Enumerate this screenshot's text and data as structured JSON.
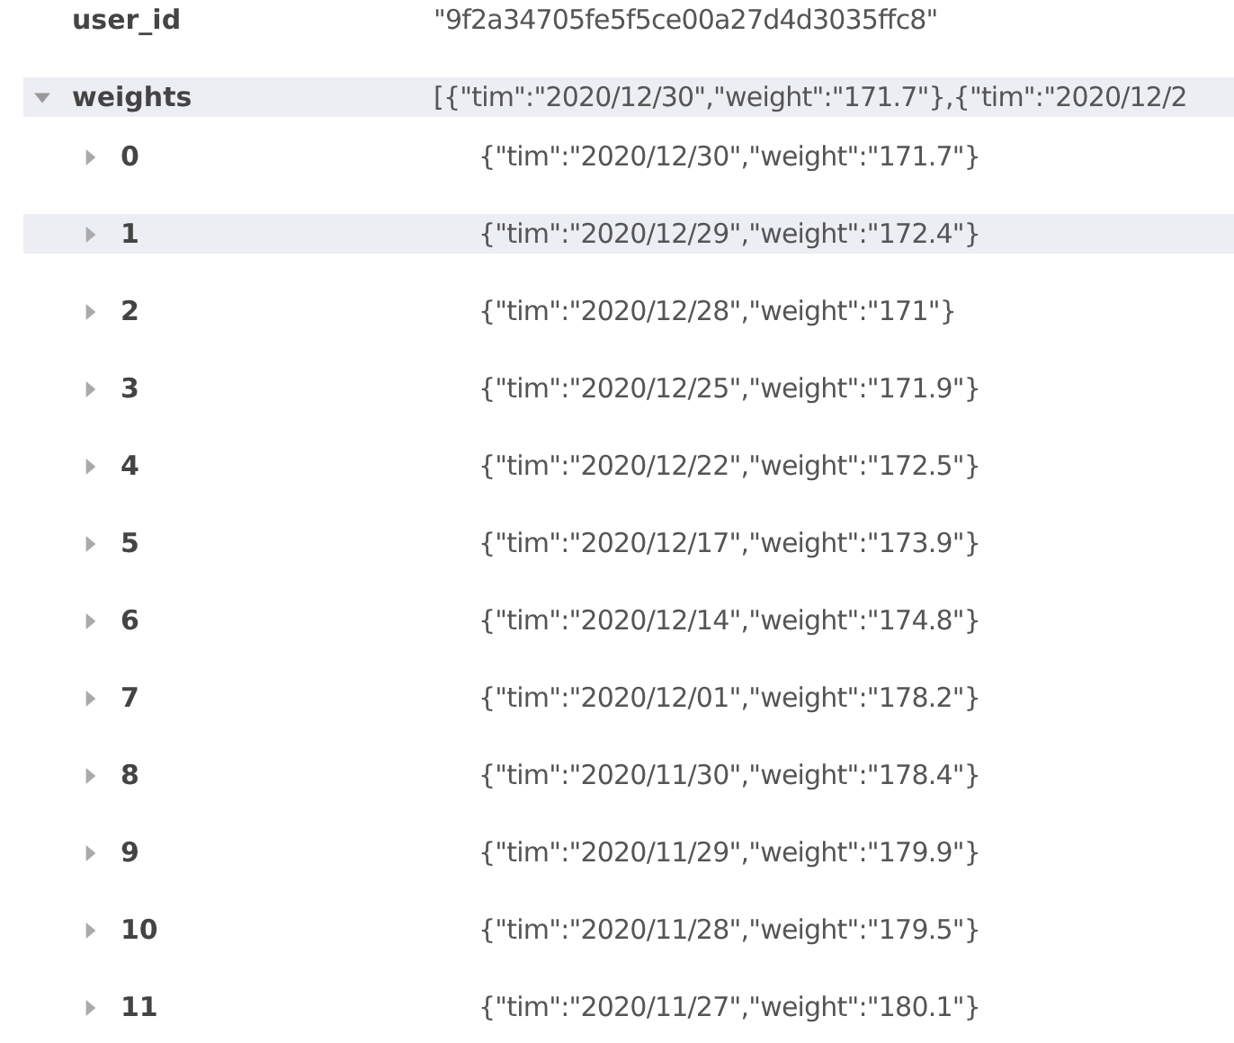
{
  "rows": [
    {
      "key": "user_id",
      "value": "\"9f2a34705fe5f5ce00a27d4d3035ffc8\"",
      "selected": false
    },
    {
      "key": "weights",
      "value": "[{\"tim\":\"2020/12/30\",\"weight\":\"171.7\"},{\"tim\":\"2020/12/2",
      "expanded": true,
      "selected": true,
      "children": [
        {
          "key": "0",
          "value": "{\"tim\":\"2020/12/30\",\"weight\":\"171.7\"}",
          "expanded": false,
          "selected": false
        },
        {
          "key": "1",
          "value": "{\"tim\":\"2020/12/29\",\"weight\":\"172.4\"}",
          "expanded": false,
          "selected": true
        },
        {
          "key": "2",
          "value": "{\"tim\":\"2020/12/28\",\"weight\":\"171\"}",
          "expanded": false,
          "selected": false
        },
        {
          "key": "3",
          "value": "{\"tim\":\"2020/12/25\",\"weight\":\"171.9\"}",
          "expanded": false,
          "selected": false
        },
        {
          "key": "4",
          "value": "{\"tim\":\"2020/12/22\",\"weight\":\"172.5\"}",
          "expanded": false,
          "selected": false
        },
        {
          "key": "5",
          "value": "{\"tim\":\"2020/12/17\",\"weight\":\"173.9\"}",
          "expanded": false,
          "selected": false
        },
        {
          "key": "6",
          "value": "{\"tim\":\"2020/12/14\",\"weight\":\"174.8\"}",
          "expanded": false,
          "selected": false
        },
        {
          "key": "7",
          "value": "{\"tim\":\"2020/12/01\",\"weight\":\"178.2\"}",
          "expanded": false,
          "selected": false
        },
        {
          "key": "8",
          "value": "{\"tim\":\"2020/11/30\",\"weight\":\"178.4\"}",
          "expanded": false,
          "selected": false
        },
        {
          "key": "9",
          "value": "{\"tim\":\"2020/11/29\",\"weight\":\"179.9\"}",
          "expanded": false,
          "selected": false
        },
        {
          "key": "10",
          "value": "{\"tim\":\"2020/11/28\",\"weight\":\"179.5\"}",
          "expanded": false,
          "selected": false
        },
        {
          "key": "11",
          "value": "{\"tim\":\"2020/11/27\",\"weight\":\"180.1\"}",
          "expanded": false,
          "selected": false
        }
      ]
    }
  ]
}
